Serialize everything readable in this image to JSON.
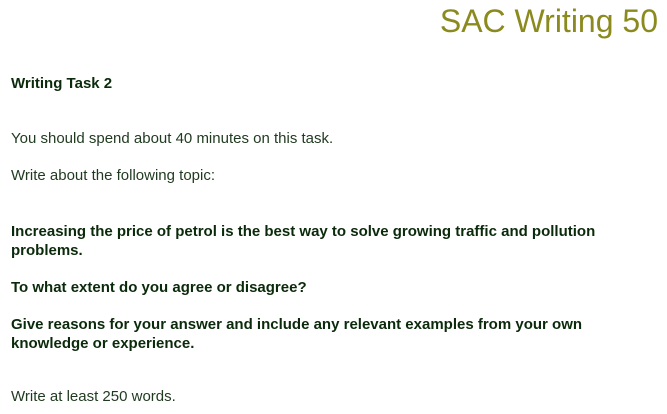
{
  "header": {
    "title": "SAC Writing 50"
  },
  "task": {
    "heading": "Writing Task 2",
    "time_instruction": "You should spend about 40 minutes on this task.",
    "topic_intro": "Write about the following topic:",
    "prompt_statement": "Increasing the price of petrol is the best way to solve growing traffic and pollution problems.",
    "question": "To what extent do you agree or disagree?",
    "guidance": "Give reasons for your answer and include any relevant examples from your own knowledge or experience.",
    "word_limit": "Write at least 250 words."
  },
  "colors": {
    "title": "#8b8a1e",
    "body_text": "#0b2a0b"
  }
}
